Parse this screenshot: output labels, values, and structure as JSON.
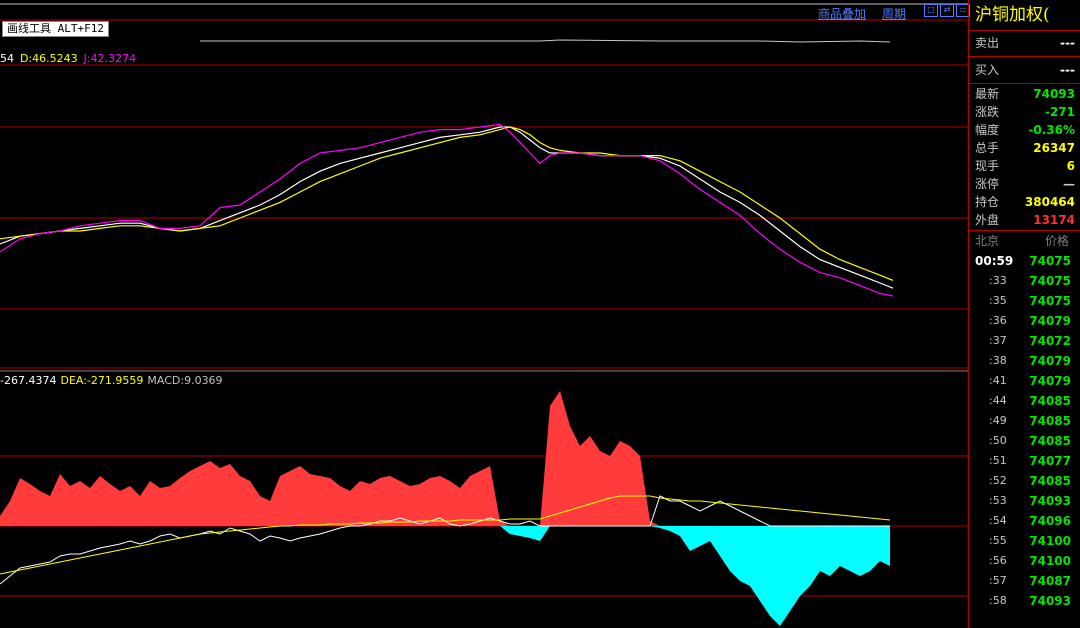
{
  "toolbar": {
    "overlay_label": "商品叠加",
    "period_label": "周期",
    "draw_tool_label": "画线工具 ALT+F12"
  },
  "kdj": {
    "k": "54",
    "d": "D:46.5243",
    "j": "J:42.3274"
  },
  "macd_header": {
    "dif": "-267.4374",
    "dea": "DEA:-271.9559",
    "macd": "MACD:9.0369"
  },
  "quote": {
    "title": "沪铜加权(",
    "rows": [
      {
        "label": "卖出",
        "value": "---",
        "color": "#ffffff"
      },
      {
        "label": "买入",
        "value": "---",
        "color": "#ffffff"
      },
      {
        "label": "最新",
        "value": "74093",
        "color": "#00e600"
      },
      {
        "label": "涨跌",
        "value": "-271",
        "color": "#00e600"
      },
      {
        "label": "幅度",
        "value": "-0.36%",
        "color": "#00e600"
      },
      {
        "label": "总手",
        "value": "26347",
        "color": "#ffff00"
      },
      {
        "label": "现手",
        "value": "6",
        "color": "#ffff00"
      },
      {
        "label": "涨停",
        "value": "—",
        "color": "#c8c8c8"
      },
      {
        "label": "持仓",
        "value": "380464",
        "color": "#ffff00"
      },
      {
        "label": "外盘",
        "value": "13174",
        "color": "#ff3030"
      }
    ],
    "ticks_header": {
      "city": "北京",
      "price": "价格"
    },
    "ticks": [
      {
        "time": "00:59",
        "price": "74075"
      },
      {
        "time": ":33",
        "price": "74075"
      },
      {
        "time": ":35",
        "price": "74075"
      },
      {
        "time": ":36",
        "price": "74079"
      },
      {
        "time": ":37",
        "price": "74072"
      },
      {
        "time": ":38",
        "price": "74079"
      },
      {
        "time": ":41",
        "price": "74079"
      },
      {
        "time": ":44",
        "price": "74085"
      },
      {
        "time": ":49",
        "price": "74085"
      },
      {
        "time": ":50",
        "price": "74085"
      },
      {
        "time": ":51",
        "price": "74077"
      },
      {
        "time": ":52",
        "price": "74085"
      },
      {
        "time": ":53",
        "price": "74093"
      },
      {
        "time": ":54",
        "price": "74096"
      },
      {
        "time": ":55",
        "price": "74100"
      },
      {
        "time": ":56",
        "price": "74100"
      },
      {
        "time": ":57",
        "price": "74087"
      },
      {
        "time": ":58",
        "price": "74093"
      }
    ]
  },
  "colors": {
    "grid": "#b00000",
    "k_line": "#ffffff",
    "d_line": "#ffff00",
    "j_line": "#ff00ff",
    "macd_pos": "#ff3b3b",
    "macd_neg": "#00ffff",
    "link": "#4f7dff"
  },
  "chart_data": [
    {
      "type": "line",
      "name": "KDJ",
      "x": [
        0,
        20,
        40,
        60,
        80,
        100,
        120,
        140,
        160,
        180,
        200,
        220,
        240,
        260,
        280,
        300,
        320,
        340,
        360,
        380,
        400,
        420,
        440,
        460,
        480,
        500,
        510,
        520,
        530,
        540,
        550,
        560,
        580,
        600,
        620,
        640,
        660,
        680,
        700,
        720,
        740,
        760,
        780,
        800,
        820,
        840,
        860,
        880,
        893
      ],
      "series": [
        {
          "name": "K",
          "values": [
            0.45,
            0.48,
            0.49,
            0.5,
            0.51,
            0.52,
            0.53,
            0.53,
            0.51,
            0.5,
            0.51,
            0.54,
            0.57,
            0.6,
            0.64,
            0.69,
            0.73,
            0.76,
            0.78,
            0.8,
            0.82,
            0.84,
            0.86,
            0.87,
            0.88,
            0.9,
            0.9,
            0.88,
            0.85,
            0.82,
            0.8,
            0.8,
            0.8,
            0.79,
            0.79,
            0.79,
            0.78,
            0.75,
            0.7,
            0.65,
            0.61,
            0.56,
            0.5,
            0.44,
            0.39,
            0.36,
            0.33,
            0.3,
            0.28
          ]
        },
        {
          "name": "D",
          "values": [
            0.47,
            0.48,
            0.49,
            0.5,
            0.5,
            0.51,
            0.52,
            0.52,
            0.51,
            0.5,
            0.51,
            0.52,
            0.55,
            0.58,
            0.61,
            0.65,
            0.69,
            0.72,
            0.75,
            0.78,
            0.8,
            0.82,
            0.84,
            0.86,
            0.87,
            0.89,
            0.9,
            0.89,
            0.87,
            0.84,
            0.82,
            0.81,
            0.8,
            0.8,
            0.79,
            0.79,
            0.79,
            0.77,
            0.73,
            0.69,
            0.65,
            0.6,
            0.55,
            0.49,
            0.43,
            0.39,
            0.36,
            0.33,
            0.31
          ]
        },
        {
          "name": "J",
          "values": [
            0.42,
            0.47,
            0.49,
            0.5,
            0.52,
            0.53,
            0.54,
            0.54,
            0.51,
            0.51,
            0.52,
            0.59,
            0.6,
            0.65,
            0.7,
            0.76,
            0.8,
            0.81,
            0.82,
            0.84,
            0.86,
            0.88,
            0.89,
            0.89,
            0.9,
            0.91,
            0.88,
            0.84,
            0.8,
            0.76,
            0.79,
            0.8,
            0.8,
            0.79,
            0.79,
            0.79,
            0.77,
            0.72,
            0.66,
            0.61,
            0.56,
            0.49,
            0.43,
            0.38,
            0.34,
            0.32,
            0.29,
            0.26,
            0.25
          ]
        }
      ]
    },
    {
      "type": "bar",
      "name": "MACD",
      "x": [
        0,
        10,
        20,
        30,
        40,
        50,
        60,
        70,
        80,
        90,
        100,
        110,
        120,
        130,
        140,
        150,
        160,
        170,
        180,
        190,
        200,
        210,
        220,
        230,
        240,
        250,
        260,
        270,
        280,
        290,
        300,
        310,
        320,
        330,
        340,
        350,
        360,
        370,
        380,
        390,
        400,
        410,
        420,
        430,
        440,
        450,
        460,
        470,
        480,
        490,
        500,
        510,
        520,
        530,
        540,
        550,
        560,
        570,
        580,
        590,
        600,
        610,
        620,
        630,
        640,
        650,
        660,
        670,
        680,
        690,
        700,
        710,
        720,
        730,
        740,
        750,
        760,
        770,
        780,
        790,
        800,
        810,
        820,
        830,
        840,
        850,
        860,
        870,
        880,
        890
      ],
      "values": [
        10,
        25,
        48,
        42,
        35,
        30,
        52,
        40,
        45,
        38,
        50,
        42,
        35,
        40,
        30,
        45,
        38,
        40,
        48,
        55,
        60,
        65,
        58,
        62,
        50,
        45,
        30,
        25,
        50,
        55,
        60,
        52,
        50,
        48,
        40,
        35,
        45,
        42,
        48,
        50,
        45,
        40,
        42,
        48,
        50,
        45,
        38,
        50,
        55,
        60,
        5,
        -8,
        -10,
        -12,
        -15,
        120,
        135,
        100,
        80,
        90,
        75,
        70,
        85,
        80,
        70,
        5,
        -2,
        -5,
        -10,
        -25,
        -20,
        -15,
        -30,
        -45,
        -55,
        -60,
        -75,
        -90,
        -100,
        -85,
        -70,
        -60,
        -45,
        -50,
        -40,
        -45,
        -50,
        -45,
        -35,
        -40
      ],
      "series": [
        {
          "name": "DIF",
          "values": [
            -58,
            -50,
            -42,
            -40,
            -38,
            -36,
            -30,
            -28,
            -28,
            -25,
            -22,
            -20,
            -18,
            -15,
            -18,
            -15,
            -10,
            -8,
            -12,
            -10,
            -8,
            -5,
            -8,
            -2,
            -5,
            -8,
            -15,
            -10,
            -12,
            -15,
            -12,
            -10,
            -8,
            -5,
            -2,
            0,
            0,
            2,
            5,
            5,
            8,
            5,
            2,
            5,
            8,
            2,
            0,
            2,
            5,
            8,
            5,
            2,
            2,
            5,
            0,
            0,
            0,
            0,
            0,
            0,
            0,
            0,
            0,
            0,
            0,
            0,
            30,
            25,
            25,
            20,
            15,
            20,
            25,
            20,
            15,
            10,
            5,
            0,
            0,
            0,
            0,
            0,
            0,
            0,
            0,
            0,
            0,
            0,
            0,
            0
          ]
        },
        {
          "name": "DEA",
          "values": [
            -48,
            -46,
            -44,
            -42,
            -40,
            -38,
            -36,
            -34,
            -32,
            -30,
            -28,
            -26,
            -24,
            -22,
            -20,
            -18,
            -16,
            -14,
            -12,
            -10,
            -8,
            -7,
            -6,
            -5,
            -4,
            -3,
            -2,
            -1,
            0,
            0,
            1,
            1,
            1,
            2,
            2,
            2,
            3,
            3,
            3,
            4,
            4,
            4,
            5,
            5,
            5,
            5,
            6,
            6,
            6,
            6,
            6,
            7,
            7,
            7,
            7,
            10,
            13,
            16,
            19,
            22,
            25,
            28,
            30,
            30,
            30,
            30,
            28,
            27,
            26,
            25,
            25,
            24,
            23,
            22,
            21,
            20,
            19,
            18,
            17,
            16,
            15,
            14,
            13,
            12,
            11,
            10,
            9,
            8,
            7,
            6
          ]
        }
      ]
    }
  ]
}
